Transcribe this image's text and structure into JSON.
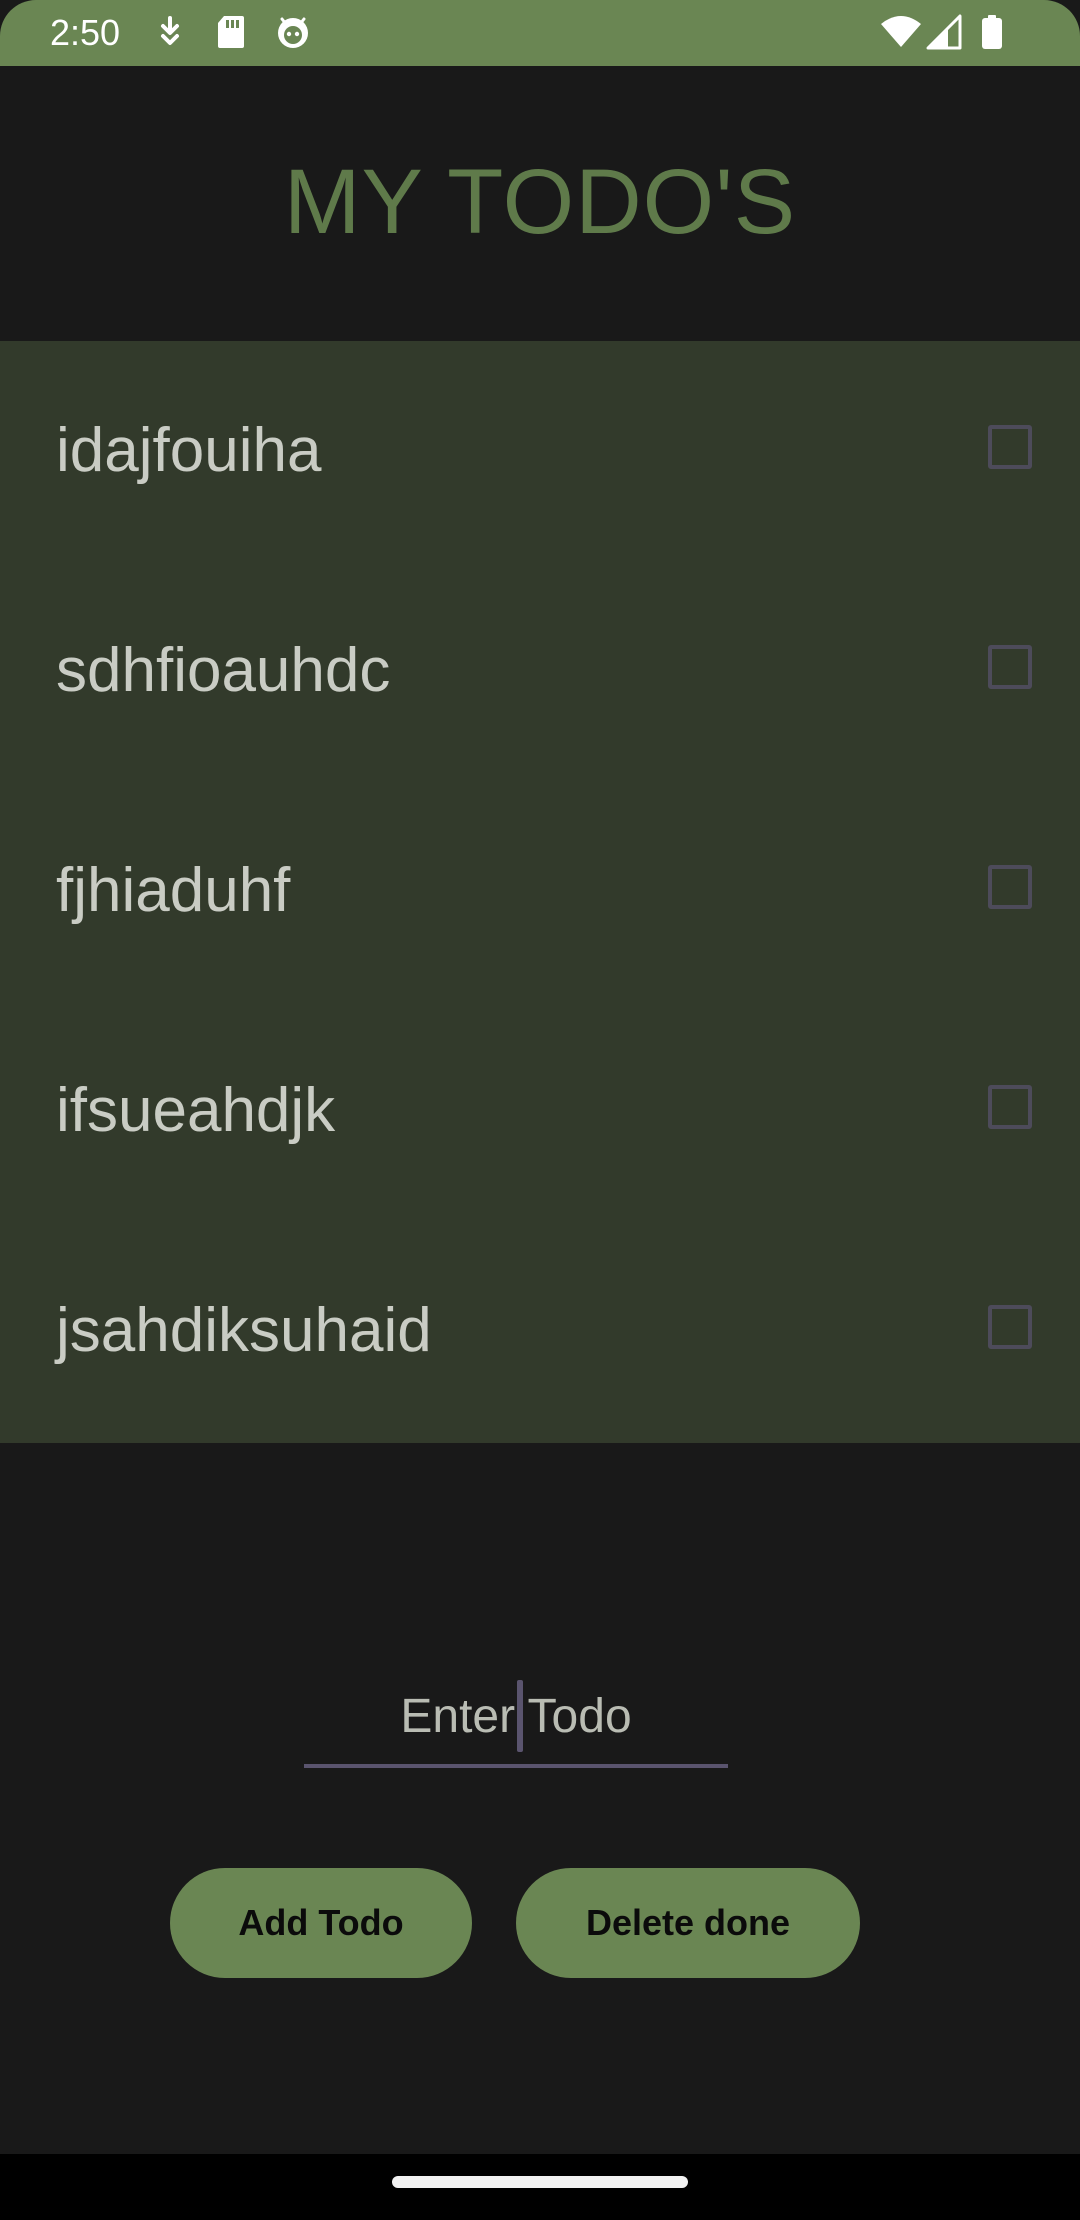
{
  "status_bar": {
    "time": "2:50",
    "left_icons": [
      "download-icon",
      "sd-card-icon",
      "android-debug-icon"
    ],
    "right_icons": [
      "wifi-icon",
      "cell-signal-icon",
      "battery-icon"
    ]
  },
  "header": {
    "title": "MY TODO'S"
  },
  "todos": [
    {
      "text": "idajfouiha",
      "checked": false
    },
    {
      "text": "sdhfioauhdc",
      "checked": false
    },
    {
      "text": "fjhiaduhf",
      "checked": false
    },
    {
      "text": "ifsueahdjk",
      "checked": false
    },
    {
      "text": "jsahdiksuhaid",
      "checked": false
    }
  ],
  "input": {
    "placeholder": "Enter Todo",
    "value": ""
  },
  "buttons": {
    "add_label": "Add Todo",
    "delete_label": "Delete done"
  },
  "colors": {
    "accent": "#6a8653",
    "title_green": "#5f7a4a",
    "list_background": "#323a2b",
    "app_background": "#191919",
    "underline": "#5a546e"
  }
}
